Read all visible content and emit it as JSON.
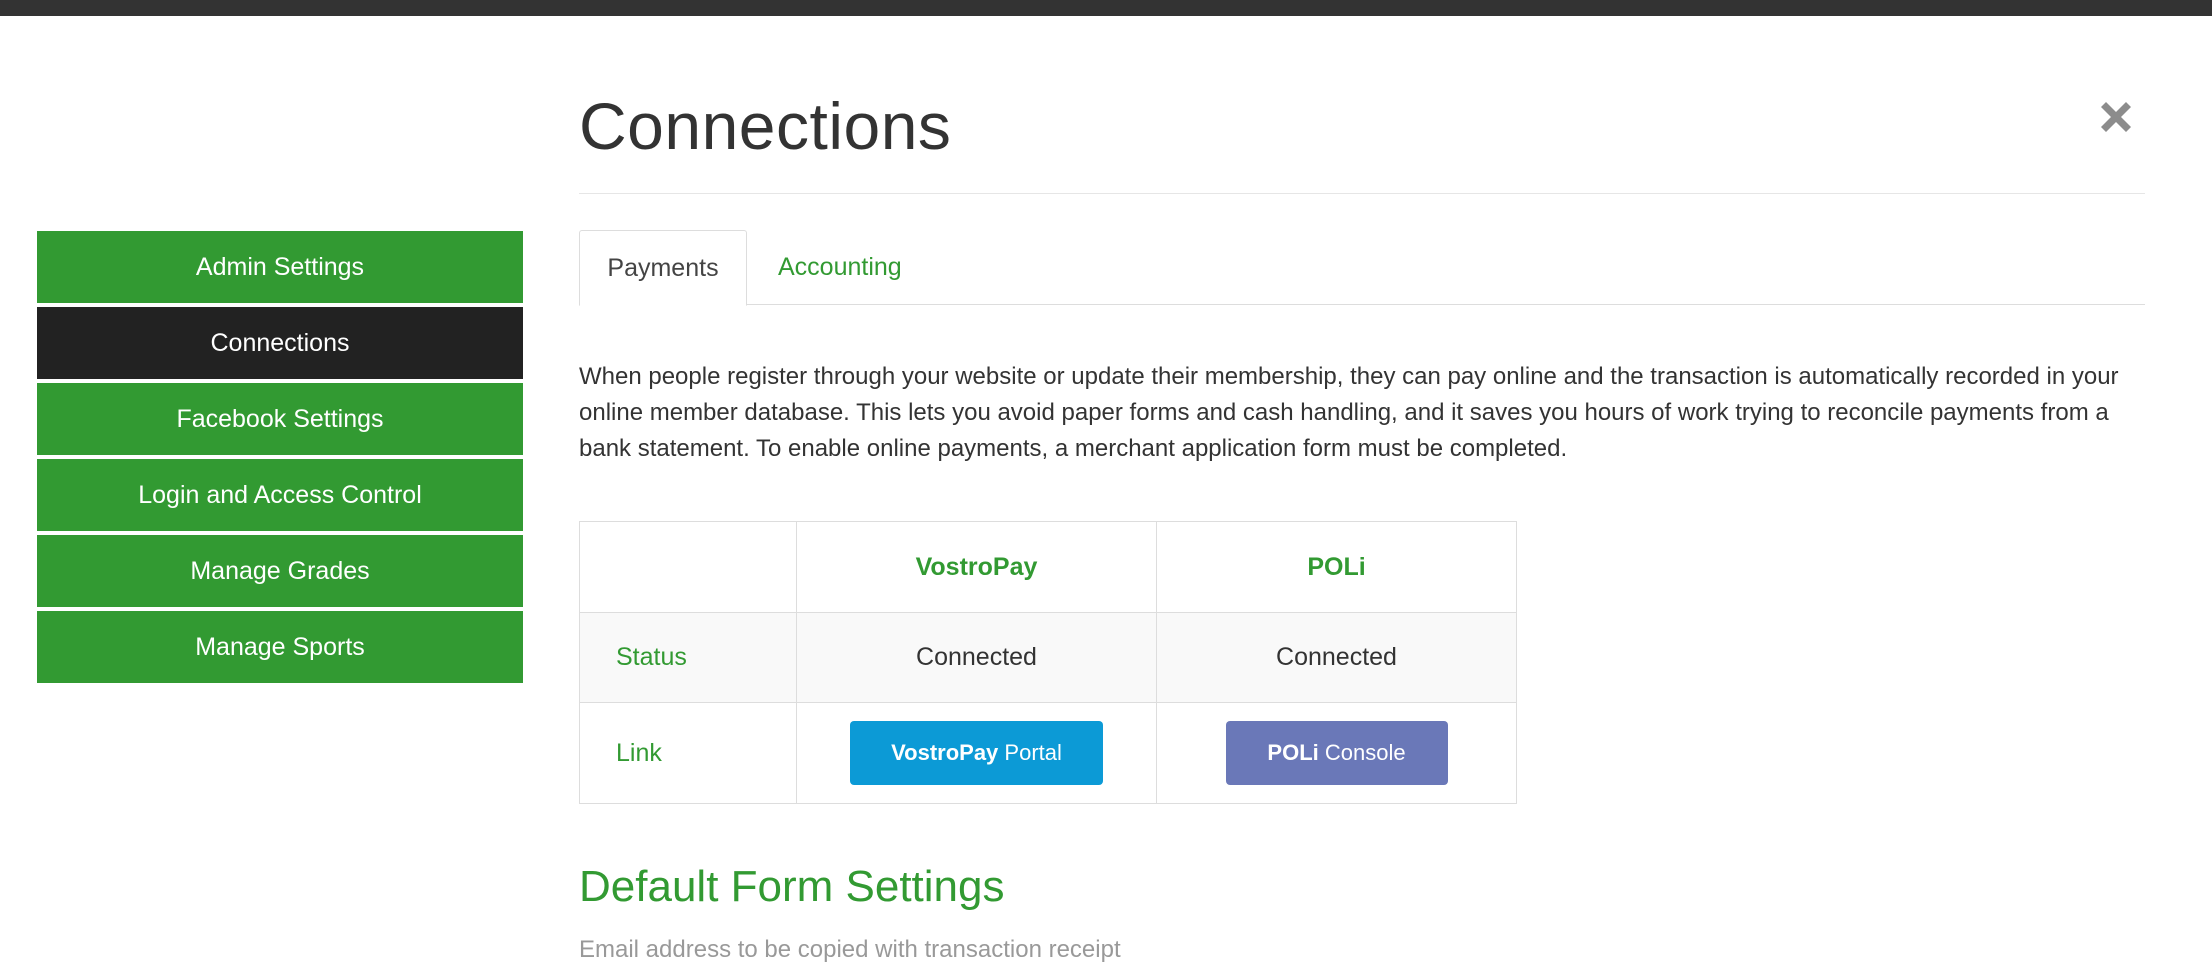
{
  "sidebar": {
    "items": [
      {
        "label": "Admin Settings"
      },
      {
        "label": "Connections",
        "active": true
      },
      {
        "label": "Facebook Settings"
      },
      {
        "label": "Login and Access Control"
      },
      {
        "label": "Manage Grades"
      },
      {
        "label": "Manage Sports"
      }
    ]
  },
  "page": {
    "title": "Connections",
    "close_icon": "close-x-icon"
  },
  "tabs": [
    {
      "label": "Payments",
      "active": true
    },
    {
      "label": "Accounting"
    }
  ],
  "intro": "When people register through your website or update their membership, they can pay online and the transaction is automatically recorded in your online member database. This lets you avoid paper forms and cash handling, and it saves you hours of work trying to reconcile payments from a bank statement. To enable online payments, a merchant application form must be completed.",
  "providers_table": {
    "headers": [
      "",
      "VostroPay",
      "POLi"
    ],
    "status_label": "Status",
    "status_values": [
      "Connected",
      "Connected"
    ],
    "link_label": "Link",
    "vostropay_button": {
      "bold": "VostroPay",
      "rest": " Portal"
    },
    "poli_button": {
      "bold": "POLi",
      "rest": " Console"
    }
  },
  "default_form": {
    "title": "Default Form Settings",
    "email_label": "Email address to be copied with transaction receipt"
  },
  "colors": {
    "accent_green": "#329a32",
    "active_dark": "#222222",
    "vostropay_blue": "#0c9ad6",
    "poli_purple": "#6a78b8"
  }
}
